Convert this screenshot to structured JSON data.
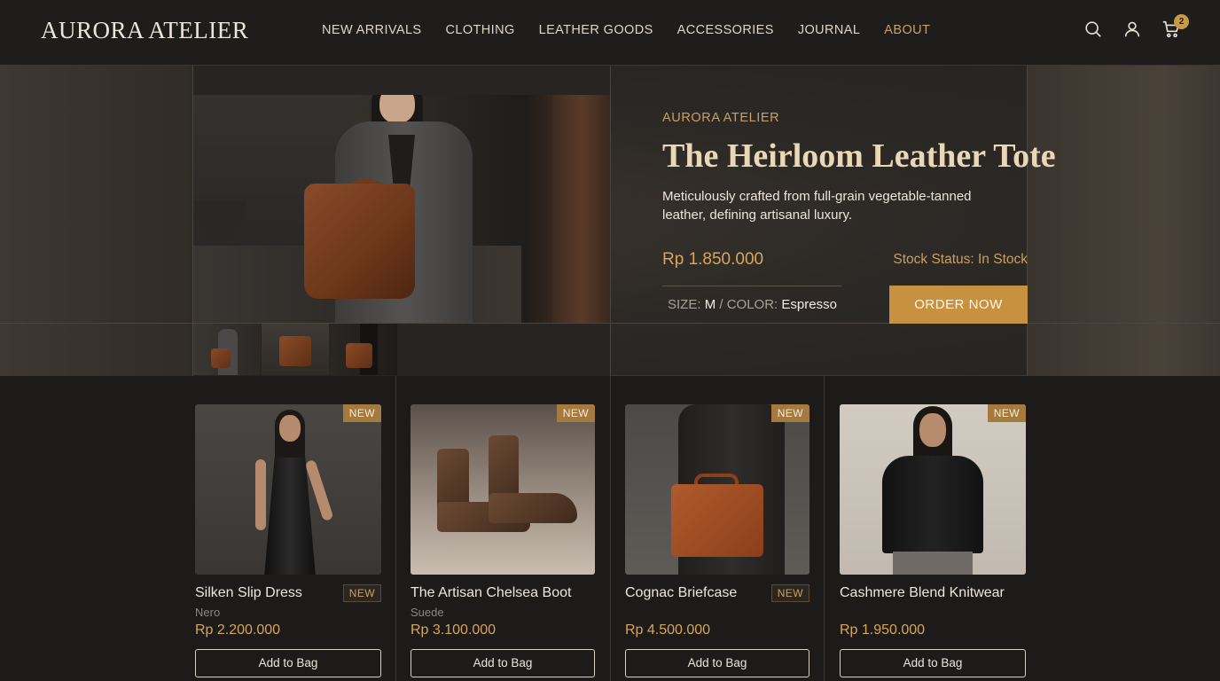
{
  "header": {
    "logo": "AURORA ATELIER",
    "nav": [
      {
        "label": "NEW ARRIVALS",
        "active": false
      },
      {
        "label": "CLOTHING",
        "active": false
      },
      {
        "label": "LEATHER GOODS",
        "active": false
      },
      {
        "label": "ACCESSORIES",
        "active": false
      },
      {
        "label": "JOURNAL",
        "active": false
      },
      {
        "label": "ABOUT",
        "active": true
      }
    ],
    "icons": [
      "search-icon",
      "user-icon",
      "cart-icon"
    ],
    "cart_count": "2"
  },
  "hero": {
    "brand": "AURORA ATELIER",
    "title": "The Heirloom Leather Tote",
    "description": "Meticulously crafted from full-grain vegetable-tanned leather, defining artisanal luxury.",
    "price": "Rp 1.850.000",
    "stock": "Stock Status: In Stock",
    "size_label": "SIZE:",
    "size_value": "M",
    "separator": "/",
    "color_label": "COLOR:",
    "color_value": "Espresso",
    "order_label": "ORDER NOW",
    "thumbnails": 3
  },
  "products": [
    {
      "name": "Silken Slip Dress",
      "variant": "Nero",
      "price": "Rp 2.200.000",
      "tag": "NEW",
      "name_badge": "NEW",
      "cta": "Add to Bag"
    },
    {
      "name": "The Artisan Chelsea Boot",
      "variant": "Suede",
      "price": "Rp 3.100.000",
      "tag": "NEW",
      "name_badge": "",
      "cta": "Add to Bag"
    },
    {
      "name": "Cognac Briefcase",
      "variant": "",
      "price": "Rp 4.500.000",
      "tag": "NEW",
      "name_badge": "NEW",
      "cta": "Add to Bag"
    },
    {
      "name": "Cashmere Blend Knitwear",
      "variant": "",
      "price": "Rp 1.950.000",
      "tag": "NEW",
      "name_badge": "",
      "cta": "Add to Bag"
    }
  ],
  "colors": {
    "accent": "#c9a062",
    "button": "#c8913f",
    "background": "#1c1b1a"
  }
}
